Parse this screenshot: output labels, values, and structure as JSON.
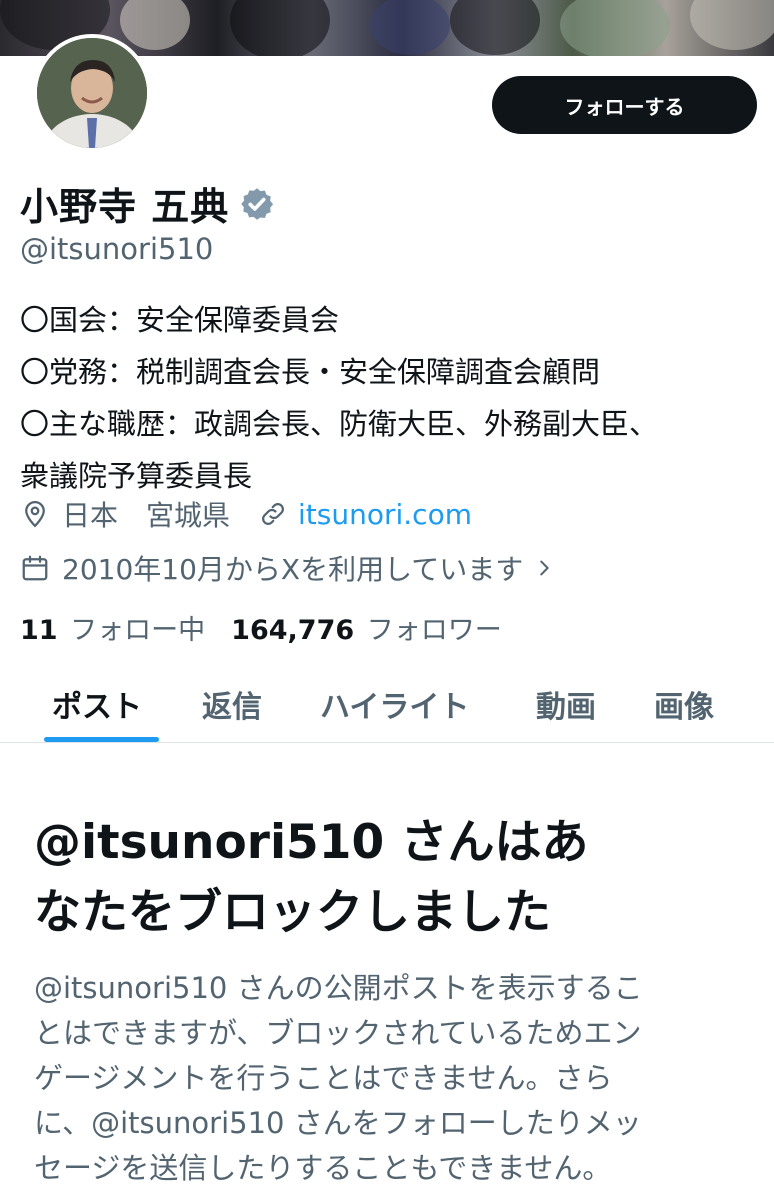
{
  "profile": {
    "display_name": "小野寺 五典",
    "handle": "@itsunori510",
    "follow_label": "フォローする",
    "bio_lines": [
      "〇国会：安全保障委員会",
      "〇党務：税制調査会長・安全保障調査会顧問",
      "〇主な職歴：政調会長、防衛大臣、外務副大臣、",
      "衆議院予算委員長"
    ],
    "location": "日本　宮城県",
    "website": "itsunori.com",
    "joined": "2010年10月からXを利用しています",
    "following_count": "11",
    "following_label": "フォロー中",
    "followers_count": "164,776",
    "followers_label": "フォロワー"
  },
  "tabs": [
    "ポスト",
    "返信",
    "ハイライト",
    "動画",
    "画像"
  ],
  "active_tab": 0,
  "blocked": {
    "title_lines": [
      "@itsunori510 さんはあ",
      "なたをブロックしました"
    ],
    "body_lines": [
      "@itsunori510 さんの公開ポストを表示するこ",
      "とはできますが、ブロックされているためエン",
      "ゲージメントを行うことはできません。さら",
      "に、@itsunori510 さんをフォローしたりメッ",
      "セージを送信したりすることもできません。"
    ]
  },
  "colors": {
    "accent": "#1d9bf0",
    "text_primary": "#0f1419",
    "text_secondary": "#536471",
    "follow_button_bg": "#0f1419",
    "verified_badge": "#829aab"
  },
  "icons": {
    "location": "location-pin-icon",
    "link": "link-icon",
    "calendar": "calendar-icon",
    "chevron": "chevron-right-icon",
    "verified": "verified-badge-icon"
  }
}
